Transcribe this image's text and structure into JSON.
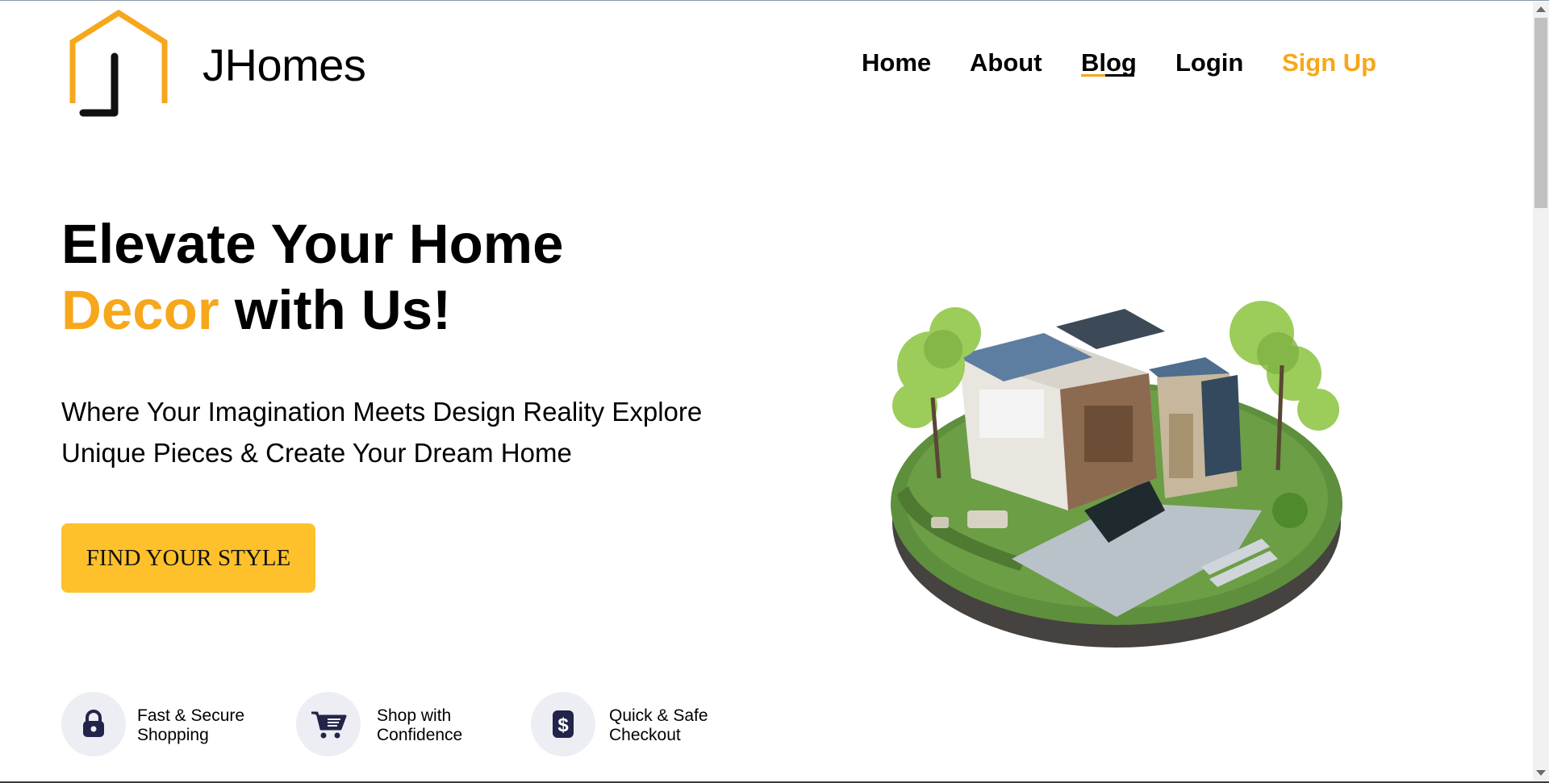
{
  "colors": {
    "accent": "#f6a71b",
    "button_bg": "#fec12b",
    "icon_circle": "#eceef3",
    "icon_dark": "#23244a"
  },
  "header": {
    "brand": "JHomes",
    "nav": {
      "home": "Home",
      "about": "About",
      "blog": "Blog",
      "login": "Login",
      "signup": "Sign Up"
    },
    "active_nav": "Blog"
  },
  "hero": {
    "title_line1": "Elevate Your Home",
    "title_accent": "Decor",
    "title_rest": " with Us!",
    "subtitle_line1": "Where Your Imagination Meets Design Reality Explore",
    "subtitle_line2": "Unique Pieces & Create Your Dream Home",
    "cta": "FIND YOUR STYLE"
  },
  "features": [
    {
      "icon": "lock-icon",
      "line1": "Fast & Secure",
      "line2": "Shopping"
    },
    {
      "icon": "cart-icon",
      "line1": "Shop with",
      "line2": "Confidence"
    },
    {
      "icon": "dollar-icon",
      "line1": "Quick & Safe",
      "line2": "Checkout"
    }
  ]
}
